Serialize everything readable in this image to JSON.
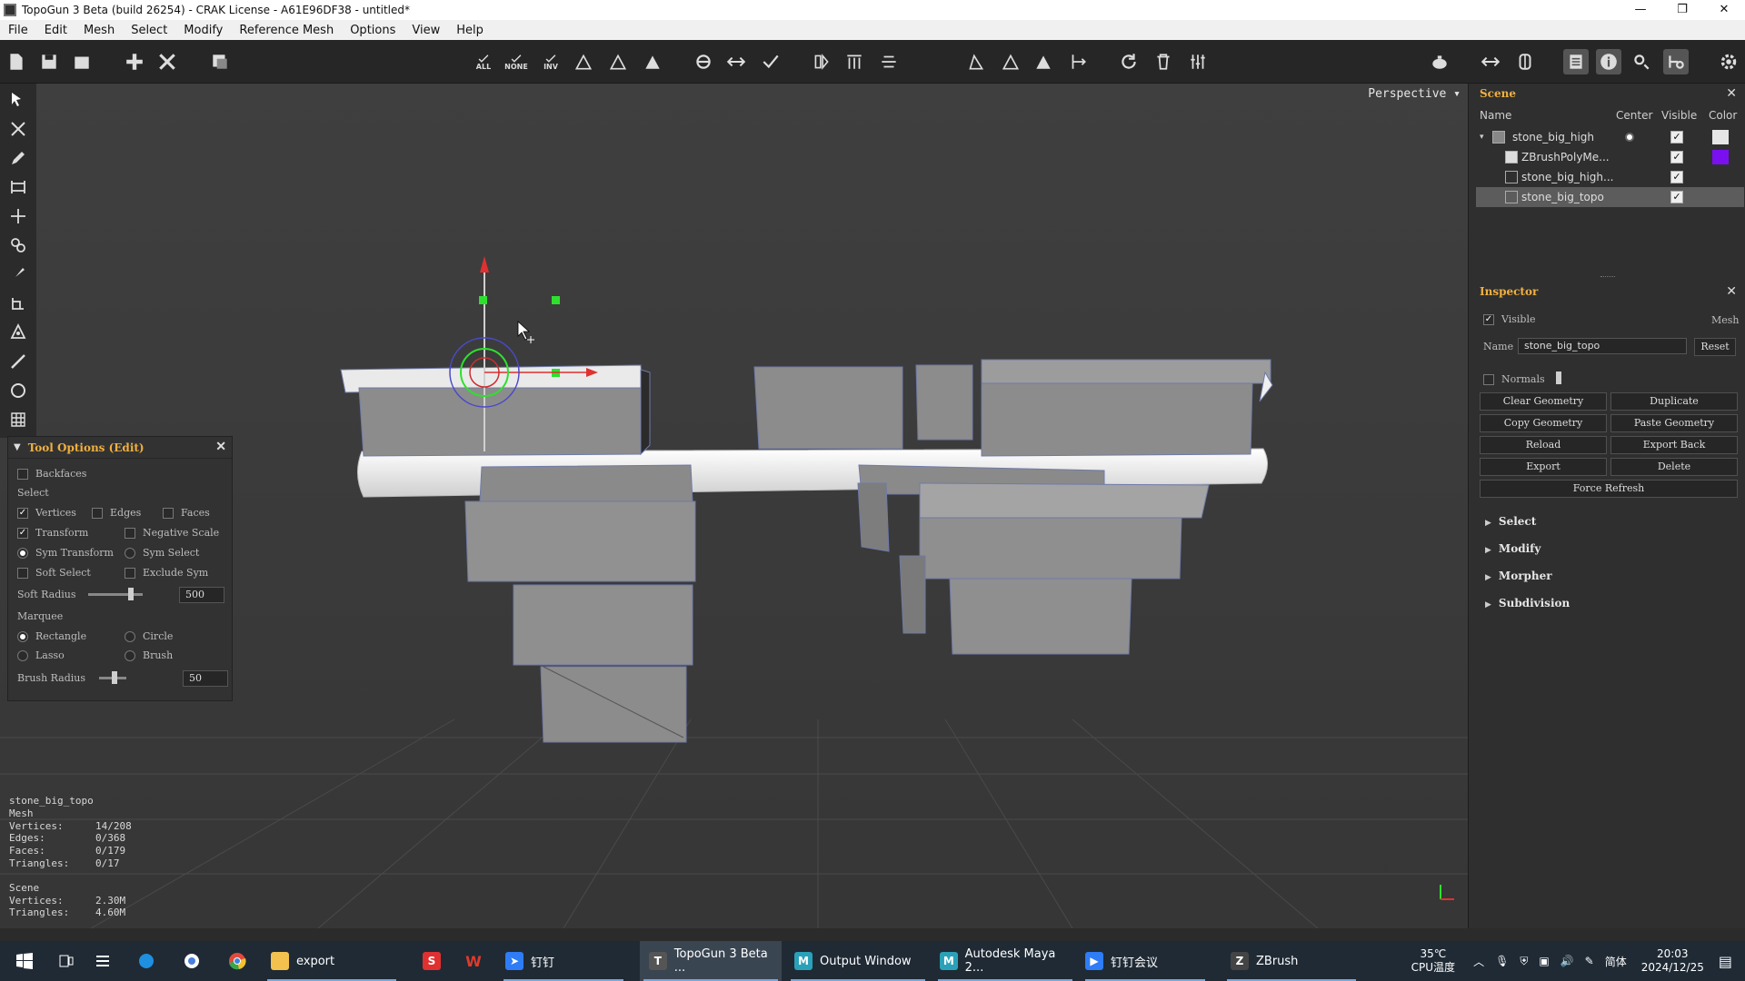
{
  "window": {
    "title": "TopoGun 3 Beta (build 26254) - CRAK License - A61E96DF38 - untitled*",
    "controls": [
      "—",
      "❐",
      "✕"
    ]
  },
  "menu": [
    "File",
    "Edit",
    "Mesh",
    "Select",
    "Modify",
    "Reference Mesh",
    "Options",
    "View",
    "Help"
  ],
  "toolbar": {
    "select_all": "ALL",
    "select_none": "NONE",
    "select_inv": "INV"
  },
  "viewport": {
    "mode": "Perspective ▾"
  },
  "tool_options": {
    "title": "Tool Options (Edit)",
    "backfaces": "Backfaces",
    "select_label": "Select",
    "vertices": "Vertices",
    "edges": "Edges",
    "faces": "Faces",
    "transform": "Transform",
    "negative_scale": "Negative Scale",
    "sym_transform": "Sym Transform",
    "sym_select": "Sym Select",
    "soft_select": "Soft Select",
    "exclude_sym": "Exclude Sym",
    "soft_radius_label": "Soft Radius",
    "soft_radius_value": "500",
    "marquee_label": "Marquee",
    "rectangle": "Rectangle",
    "circle": "Circle",
    "lasso": "Lasso",
    "brush": "Brush",
    "brush_radius_label": "Brush Radius",
    "brush_radius_value": "50"
  },
  "stats": {
    "object_name": "stone_big_topo",
    "object_type": "Mesh",
    "vertices_label": "Vertices:",
    "vertices": "14/208",
    "edges_label": "Edges:",
    "edges": "0/368",
    "faces_label": "Faces:",
    "faces": "0/179",
    "triangles_label": "Triangles:",
    "triangles": "0/17",
    "scene_label": "Scene",
    "scene_vertices_label": "Vertices:",
    "scene_vertices": "2.30M",
    "scene_triangles_label": "Triangles:",
    "scene_triangles": "4.60M"
  },
  "scene_panel": {
    "title": "Scene",
    "col_name": "Name",
    "col_center": "Center",
    "col_visible": "Visible",
    "col_color": "Color",
    "items": [
      {
        "name": "stone_big_high",
        "color": "#e6e6e6"
      },
      {
        "name": "ZBrushPolyMe...",
        "color": "#7a10f0"
      },
      {
        "name": "stone_big_high...",
        "color": ""
      },
      {
        "name": "stone_big_topo",
        "color": ""
      }
    ]
  },
  "inspector": {
    "title": "Inspector",
    "visible_label": "Visible",
    "type": "Mesh",
    "name_label": "Name",
    "name_value": "stone_big_topo",
    "reset": "Reset",
    "normals_label": "Normals",
    "buttons": [
      "Clear Geometry",
      "Duplicate",
      "Copy Geometry",
      "Paste Geometry",
      "Reload",
      "Export Back",
      "Export",
      "Delete"
    ],
    "force_refresh": "Force Refresh",
    "sections": [
      "Select",
      "Modify",
      "Morpher",
      "Subdivision"
    ]
  },
  "taskbar": {
    "apps": [
      {
        "label": "export",
        "icon": "folder-icon",
        "color": "#f2c14e"
      },
      {
        "label": "",
        "icon": "s-app-icon",
        "color": "#e03030"
      },
      {
        "label": "",
        "icon": "wps-icon",
        "color": "#d83b2a"
      },
      {
        "label": "钉钉",
        "icon": "dingtalk-icon",
        "color": "#2e7cf6"
      },
      {
        "label": "TopoGun 3 Beta ...",
        "icon": "topogun-icon",
        "color": "#555555"
      },
      {
        "label": "Output Window",
        "icon": "maya-icon",
        "color": "#2aa1b8"
      },
      {
        "label": "Autodesk Maya 2...",
        "icon": "maya-icon",
        "color": "#2aa1b8"
      },
      {
        "label": "钉钉会议",
        "icon": "meeting-icon",
        "color": "#2e7cf6"
      },
      {
        "label": "ZBrush",
        "icon": "zbrush-icon",
        "color": "#444444"
      }
    ],
    "temp": "35℃",
    "temp_label": "CPU温度",
    "ime": "简体",
    "time": "20:03",
    "date": "2024/12/25"
  }
}
